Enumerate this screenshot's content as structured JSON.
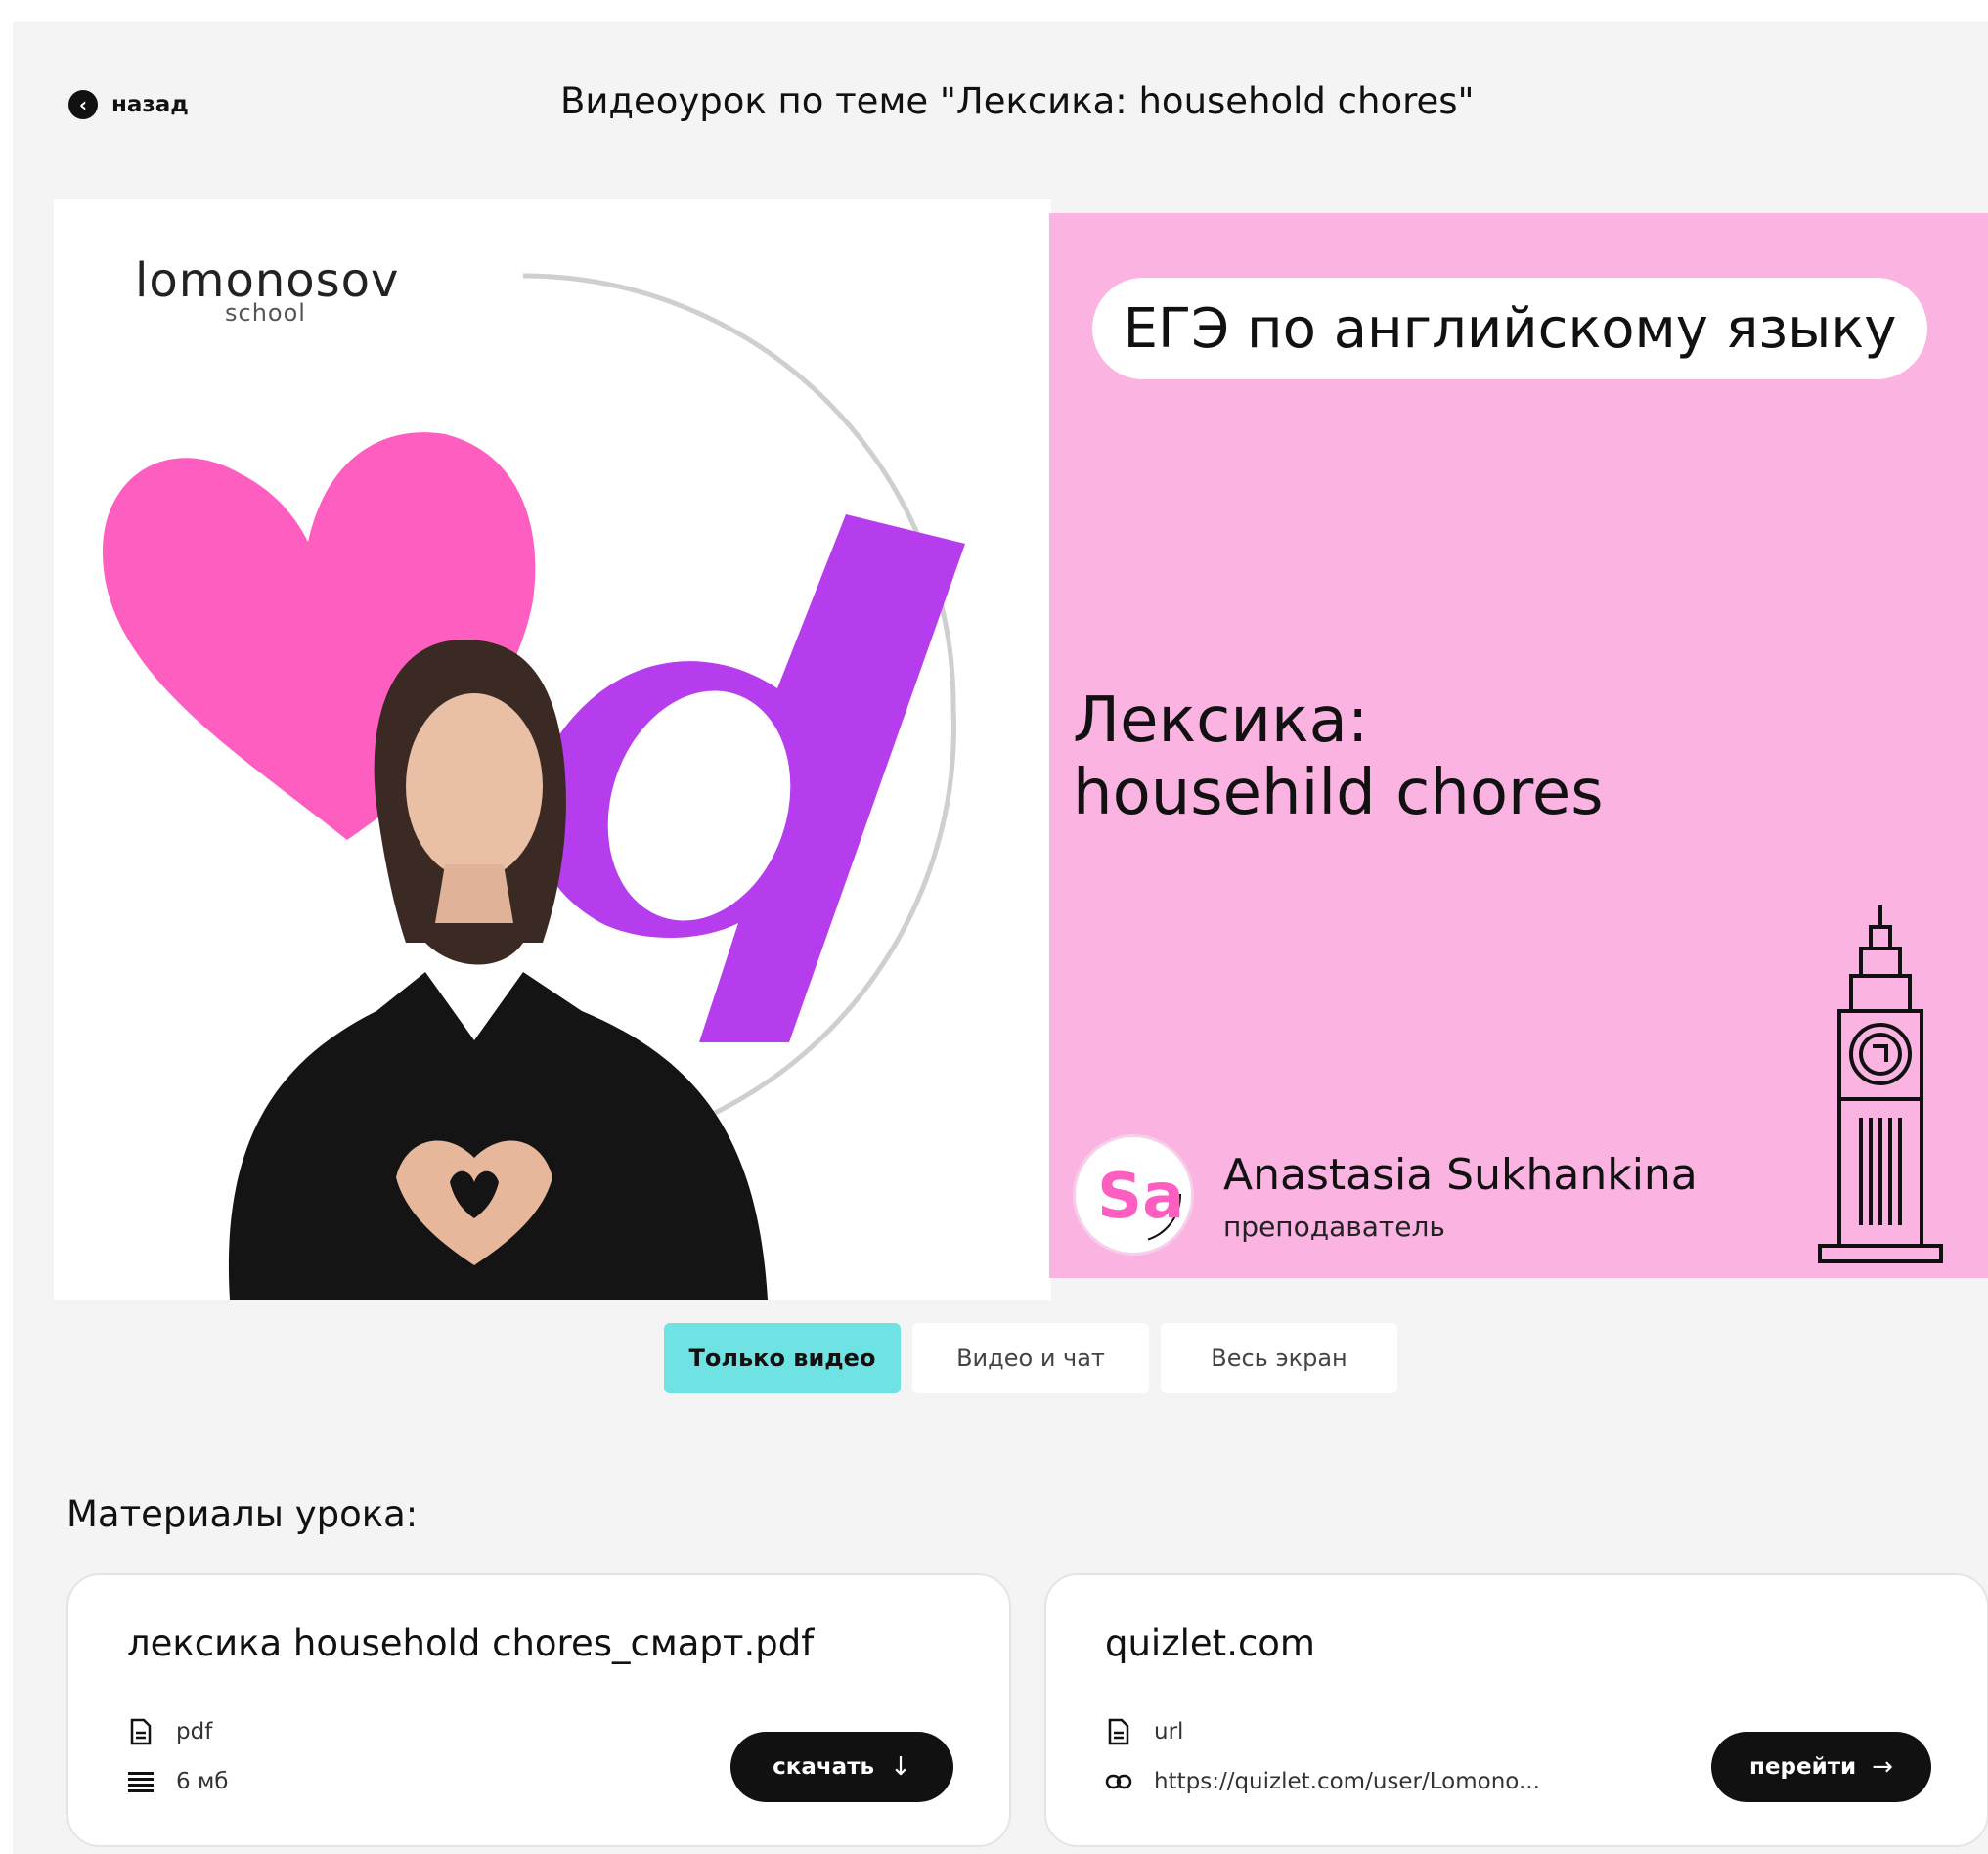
{
  "header": {
    "back_label": "назад",
    "title": "Видеоурок по теме \"Лексика: household chores\""
  },
  "video": {
    "brand_name": "lomonosov",
    "brand_sub": "school",
    "exam_label": "ЕГЭ по английскому языку",
    "topic_line1": "Лексика:",
    "topic_line2": "househild chores",
    "teacher_name": "Anastasia Sukhankina",
    "teacher_role": "преподаватель",
    "teacher_initials": "Sa",
    "colors": {
      "banner_pink": "#fbb3e1",
      "heart": "#ff5ec1",
      "letter_purple": "#b63ded"
    }
  },
  "view_modes": [
    {
      "label": "Только видео",
      "active": true
    },
    {
      "label": "Видео и чат",
      "active": false
    },
    {
      "label": "Весь экран",
      "active": false
    }
  ],
  "materials": {
    "heading": "Материалы урока:",
    "items": [
      {
        "title": "лексика household chores_смарт.pdf",
        "type": "pdf",
        "type_icon": "file-icon",
        "detail": "6 мб",
        "detail_icon": "list-icon",
        "action": "скачать",
        "action_icon": "arrow-down-icon"
      },
      {
        "title": "quizlet.com",
        "type": "url",
        "type_icon": "file-icon",
        "detail": "https://quizlet.com/user/Lomono...",
        "detail_icon": "link-icon",
        "action": "перейти",
        "action_icon": "arrow-right-icon"
      }
    ]
  }
}
